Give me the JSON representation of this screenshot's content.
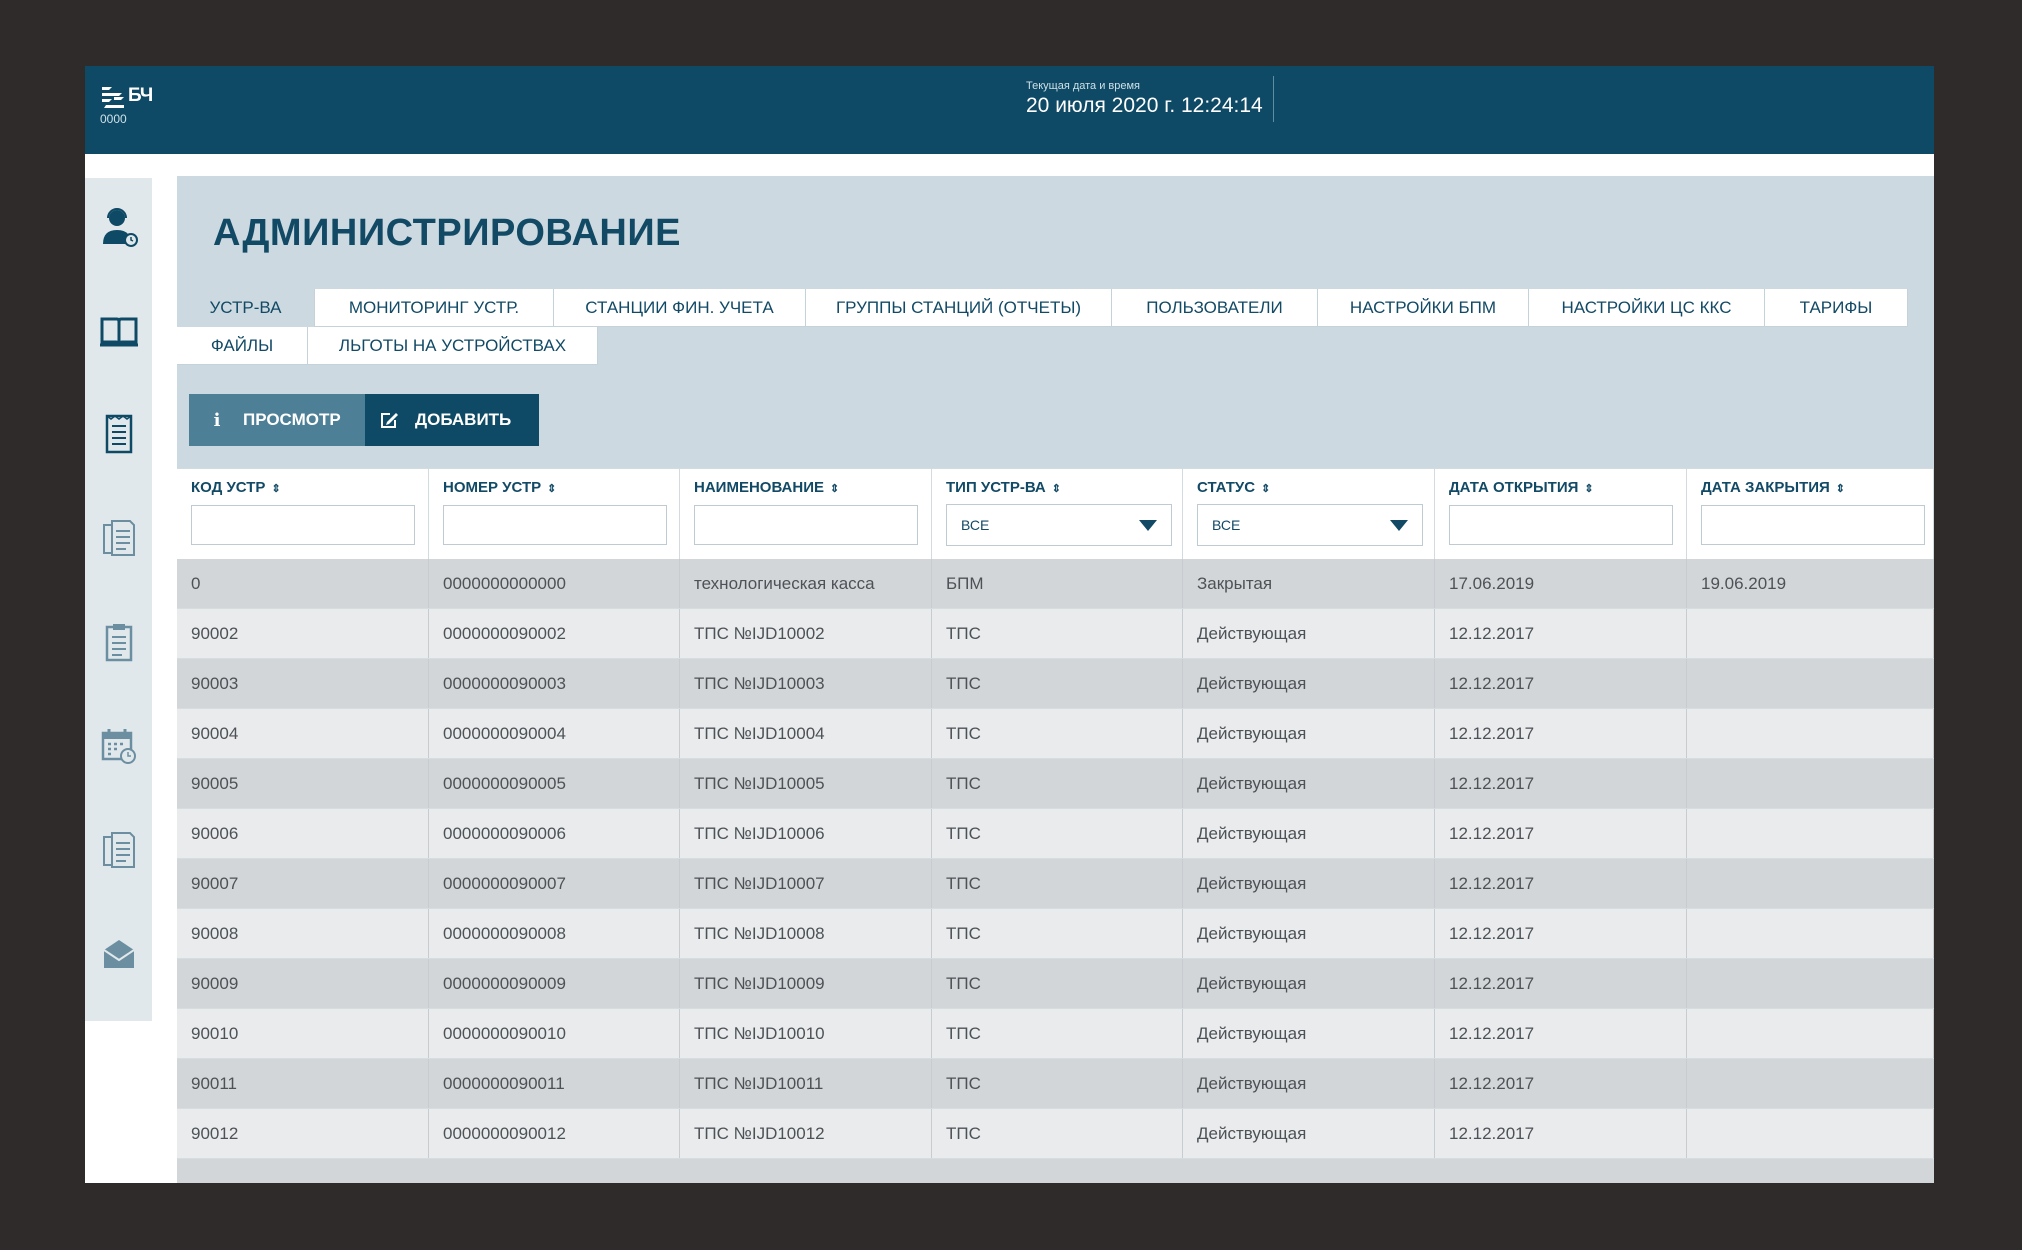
{
  "header": {
    "logo_text": "БЧ",
    "logo_code": "0000",
    "datetime_label": "Текущая дата и время",
    "datetime_value": "20 июля 2020 г. 12:24:14"
  },
  "sidebar": {
    "items": [
      {
        "icon": "operator-icon"
      },
      {
        "icon": "book-icon"
      },
      {
        "icon": "receipt-icon"
      },
      {
        "icon": "documents-icon"
      },
      {
        "icon": "clipboard-icon"
      },
      {
        "icon": "calendar-clock-icon"
      },
      {
        "icon": "documents-copy-icon"
      },
      {
        "icon": "envelope-open-icon"
      }
    ]
  },
  "page": {
    "title": "АДМИНИСТРИРОВАНИЕ"
  },
  "tabs": [
    {
      "label": "УСТР-ВА",
      "active": true
    },
    {
      "label": "МОНИТОРИНГ УСТР."
    },
    {
      "label": "СТАНЦИИ ФИН. УЧЕТА"
    },
    {
      "label": "ГРУППЫ СТАНЦИЙ (ОТЧЕТЫ)"
    },
    {
      "label": "ПОЛЬЗОВАТЕЛИ"
    },
    {
      "label": "НАСТРОЙКИ БПМ"
    },
    {
      "label": "НАСТРОЙКИ ЦС ККС"
    },
    {
      "label": "ТАРИФЫ"
    },
    {
      "label": "ФАЙЛЫ"
    },
    {
      "label": "ЛЬГОТЫ НА УСТРОЙСТВАХ"
    }
  ],
  "toolbar": {
    "view_icon": "i",
    "view_label": "ПРОСМОТР",
    "add_label": "ДОБАВИТЬ"
  },
  "table": {
    "columns": [
      {
        "label": "КОД УСТР",
        "filter": "input",
        "value": ""
      },
      {
        "label": "НОМЕР УСТР",
        "filter": "input",
        "value": ""
      },
      {
        "label": "НАИМЕНОВАНИЕ",
        "filter": "input",
        "value": ""
      },
      {
        "label": "ТИП УСТР-ВА",
        "filter": "select",
        "value": "ВСЕ"
      },
      {
        "label": "СТАТУС",
        "filter": "select",
        "value": "ВСЕ"
      },
      {
        "label": "ДАТА ОТКРЫТИЯ",
        "filter": "input",
        "value": ""
      },
      {
        "label": "ДАТА ЗАКРЫТИЯ",
        "filter": "input",
        "value": ""
      }
    ],
    "sort_icon": "⇕",
    "rows": [
      [
        "0",
        "0000000000000",
        "технологическая касса",
        "БПМ",
        "Закрытая",
        "17.06.2019",
        "19.06.2019"
      ],
      [
        "90002",
        "0000000090002",
        "ТПС №IJD10002",
        "ТПС",
        "Действующая",
        "12.12.2017",
        ""
      ],
      [
        "90003",
        "0000000090003",
        "ТПС №IJD10003",
        "ТПС",
        "Действующая",
        "12.12.2017",
        ""
      ],
      [
        "90004",
        "0000000090004",
        "ТПС №IJD10004",
        "ТПС",
        "Действующая",
        "12.12.2017",
        ""
      ],
      [
        "90005",
        "0000000090005",
        "ТПС №IJD10005",
        "ТПС",
        "Действующая",
        "12.12.2017",
        ""
      ],
      [
        "90006",
        "0000000090006",
        "ТПС №IJD10006",
        "ТПС",
        "Действующая",
        "12.12.2017",
        ""
      ],
      [
        "90007",
        "0000000090007",
        "ТПС №IJD10007",
        "ТПС",
        "Действующая",
        "12.12.2017",
        ""
      ],
      [
        "90008",
        "0000000090008",
        "ТПС №IJD10008",
        "ТПС",
        "Действующая",
        "12.12.2017",
        ""
      ],
      [
        "90009",
        "0000000090009",
        "ТПС №IJD10009",
        "ТПС",
        "Действующая",
        "12.12.2017",
        ""
      ],
      [
        "90010",
        "0000000090010",
        "ТПС №IJD10010",
        "ТПС",
        "Действующая",
        "12.12.2017",
        ""
      ],
      [
        "90011",
        "0000000090011",
        "ТПС №IJD10011",
        "ТПС",
        "Действующая",
        "12.12.2017",
        ""
      ],
      [
        "90012",
        "0000000090012",
        "ТПС №IJD10012",
        "ТПС",
        "Действующая",
        "12.12.2017",
        ""
      ]
    ]
  }
}
